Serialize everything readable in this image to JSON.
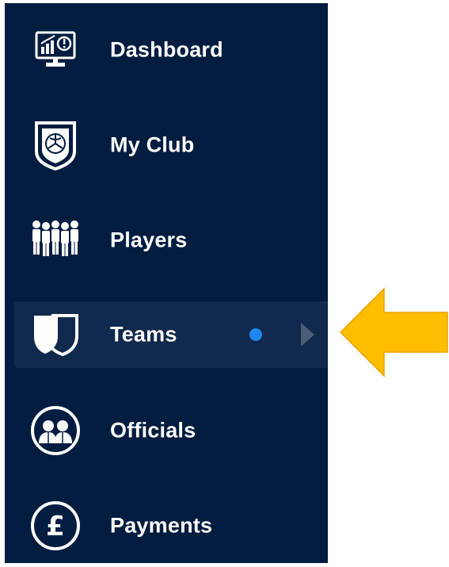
{
  "sidebar": {
    "items": [
      {
        "label": "Dashboard",
        "icon": "dashboard-monitor-icon"
      },
      {
        "label": "My Club",
        "icon": "club-crest-icon"
      },
      {
        "label": "Players",
        "icon": "players-group-icon"
      },
      {
        "label": "Teams",
        "icon": "team-shield-icon",
        "active": true,
        "has_notification": true,
        "has_submenu": true
      },
      {
        "label": "Officials",
        "icon": "officials-icon"
      },
      {
        "label": "Payments",
        "icon": "pound-icon"
      }
    ]
  },
  "colors": {
    "sidebar_bg": "#031d40",
    "active_bg": "#10294c",
    "notification_dot": "#1e88f0",
    "callout_arrow": "#ffbd00",
    "text": "#ffffff"
  },
  "annotation": {
    "icon": "pointer-arrow-icon"
  }
}
